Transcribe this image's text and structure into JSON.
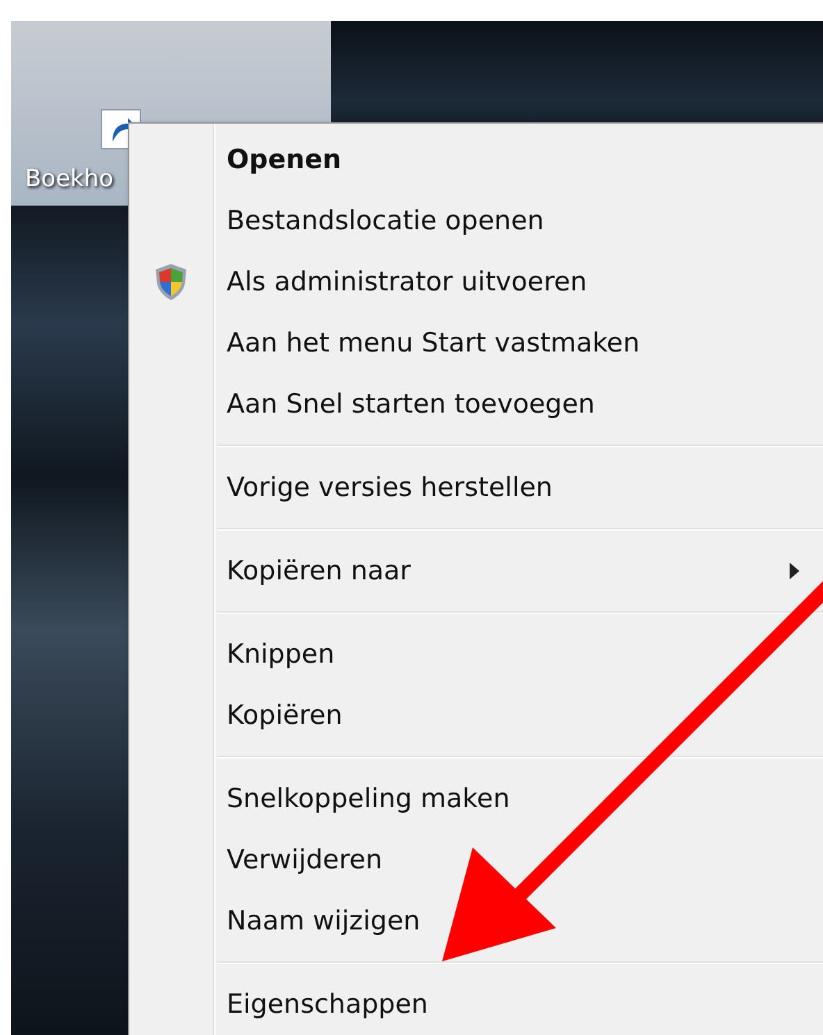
{
  "desktop_icon": {
    "label": "Boekho",
    "selected": true
  },
  "context_menu": {
    "groups": [
      {
        "items": [
          {
            "label": "Openen",
            "kind": "default"
          },
          {
            "label": "Bestandslocatie openen",
            "kind": "plain"
          },
          {
            "label": "Als administrator uitvoeren",
            "kind": "shield"
          },
          {
            "label": "Aan het menu Start vastmaken",
            "kind": "plain"
          },
          {
            "label": "Aan Snel starten toevoegen",
            "kind": "plain"
          }
        ]
      },
      {
        "items": [
          {
            "label": "Vorige versies herstellen",
            "kind": "plain"
          }
        ]
      },
      {
        "items": [
          {
            "label": "Kopiëren naar",
            "kind": "submenu"
          }
        ]
      },
      {
        "items": [
          {
            "label": "Knippen",
            "kind": "plain"
          },
          {
            "label": "Kopiëren",
            "kind": "plain"
          }
        ]
      },
      {
        "items": [
          {
            "label": "Snelkoppeling maken",
            "kind": "plain"
          },
          {
            "label": "Verwijderen",
            "kind": "plain"
          },
          {
            "label": "Naam wijzigen",
            "kind": "plain"
          }
        ]
      },
      {
        "items": [
          {
            "label": "Eigenschappen",
            "kind": "plain"
          }
        ]
      }
    ]
  }
}
